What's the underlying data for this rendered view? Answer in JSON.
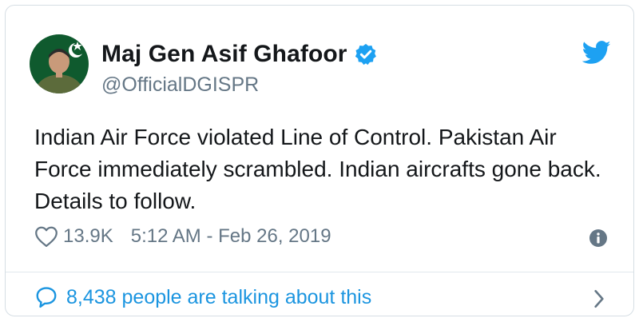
{
  "tweet": {
    "author_name": "Maj Gen Asif Ghafoor",
    "handle": "@OfficialDGISPR",
    "text": "Indian Air Force violated Line of Control. Pakistan Air Force immediately scrambled. Indian aircrafts gone back. Details to follow.",
    "likes": "13.9K",
    "timestamp": "5:12 AM - Feb 26, 2019",
    "talking_about": "8,438 people are talking about this"
  },
  "icons": {
    "verified": "verified-badge-icon",
    "brand": "twitter-bird-icon",
    "like": "heart-icon",
    "info": "info-icon",
    "reply": "speech-bubble-icon",
    "more": "chevron-right-icon"
  },
  "colors": {
    "accent": "#1da1f2",
    "link": "#1b95e0",
    "muted": "#657786",
    "text": "#14171a",
    "border": "#d6dee4"
  }
}
